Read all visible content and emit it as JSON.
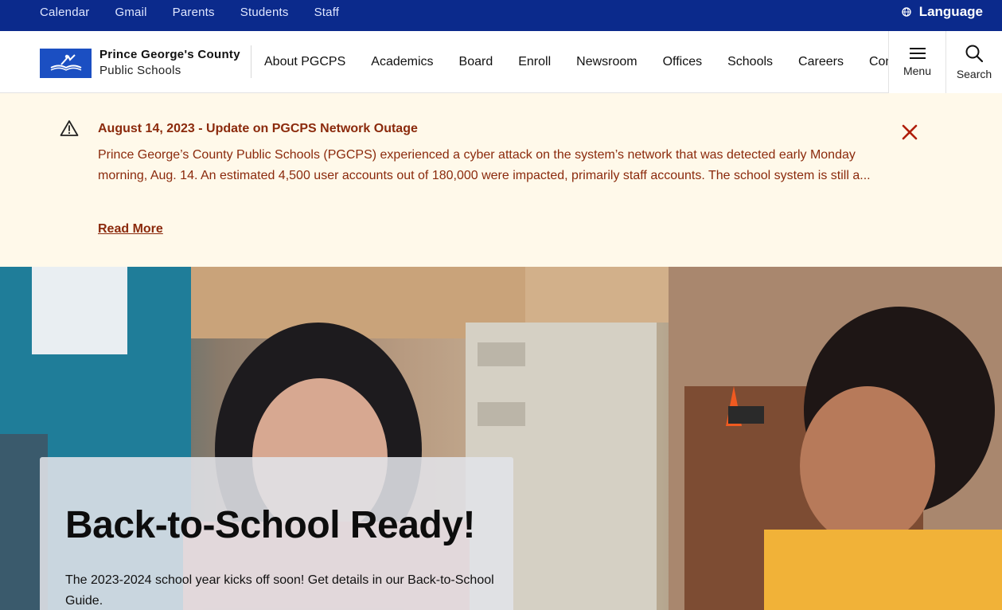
{
  "utility": {
    "links": [
      "Calendar",
      "Gmail",
      "Parents",
      "Students",
      "Staff"
    ],
    "language_label": "Language"
  },
  "header": {
    "logo_line1": "Prince George's County",
    "logo_line2": "Public Schools",
    "nav": [
      "About PGCPS",
      "Academics",
      "Board",
      "Enroll",
      "Newsroom",
      "Offices",
      "Schools",
      "Careers",
      "Contact"
    ],
    "menu_label": "Menu",
    "search_label": "Search"
  },
  "alert": {
    "title": "August 14, 2023 - Update on PGCPS Network Outage",
    "body": "Prince George’s County Public Schools (PGCPS) experienced a cyber attack on the system’s network that was detected early Monday morning, Aug. 14. An estimated 4,500 user accounts out of 180,000 were impacted, primarily staff accounts. The school system is still a...",
    "link": "Read More"
  },
  "hero": {
    "title": "Back-to-School Ready!",
    "text": "The 2023-2024 school year kicks off soon! Get details in our Back-to-School Guide."
  },
  "colors": {
    "utility_bg": "#0b2a8c",
    "logo_blue": "#1b4fc2",
    "alert_bg": "#fff9ea",
    "alert_text": "#8b2a0c"
  },
  "icons": {
    "globe": "globe-icon",
    "menu": "hamburger-icon",
    "search": "search-icon",
    "alert": "warning-triangle-icon",
    "close": "close-icon"
  }
}
